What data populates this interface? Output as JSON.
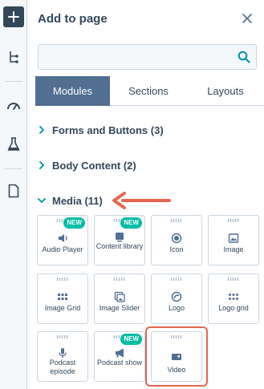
{
  "panel": {
    "title": "Add to page",
    "search": {
      "value": "",
      "placeholder": ""
    }
  },
  "tabs": [
    {
      "label": "Modules",
      "active": true
    },
    {
      "label": "Sections",
      "active": false
    },
    {
      "label": "Layouts",
      "active": false
    }
  ],
  "sections": [
    {
      "label": "Forms and Buttons (3)",
      "expanded": false
    },
    {
      "label": "Body Content (2)",
      "expanded": false
    },
    {
      "label": "Media (11)",
      "expanded": true
    }
  ],
  "modules": [
    {
      "label": "Audio Player",
      "icon": "speaker-icon",
      "badge": "NEW"
    },
    {
      "label": "Content library",
      "icon": "library-icon",
      "badge": "NEW"
    },
    {
      "label": "Icon",
      "icon": "circle-icon",
      "badge": ""
    },
    {
      "label": "Image",
      "icon": "image-icon",
      "badge": ""
    },
    {
      "label": "Image Grid",
      "icon": "grid-icon",
      "badge": ""
    },
    {
      "label": "Image Slider",
      "icon": "slider-icon",
      "badge": ""
    },
    {
      "label": "Logo",
      "icon": "logo-icon",
      "badge": ""
    },
    {
      "label": "Logo grid",
      "icon": "logo-grid-icon",
      "badge": ""
    },
    {
      "label": "Podcast episode",
      "icon": "microphone-icon",
      "badge": ""
    },
    {
      "label": "Podcast show",
      "icon": "megaphone-icon",
      "badge": "NEW"
    },
    {
      "label": "Video",
      "icon": "video-icon",
      "badge": "",
      "highlighted": true
    }
  ],
  "colors": {
    "accent": "#516f90",
    "badge": "#00bda5",
    "annotation": "#e5664d",
    "text": "#33475b",
    "border": "#cbd6e2"
  }
}
